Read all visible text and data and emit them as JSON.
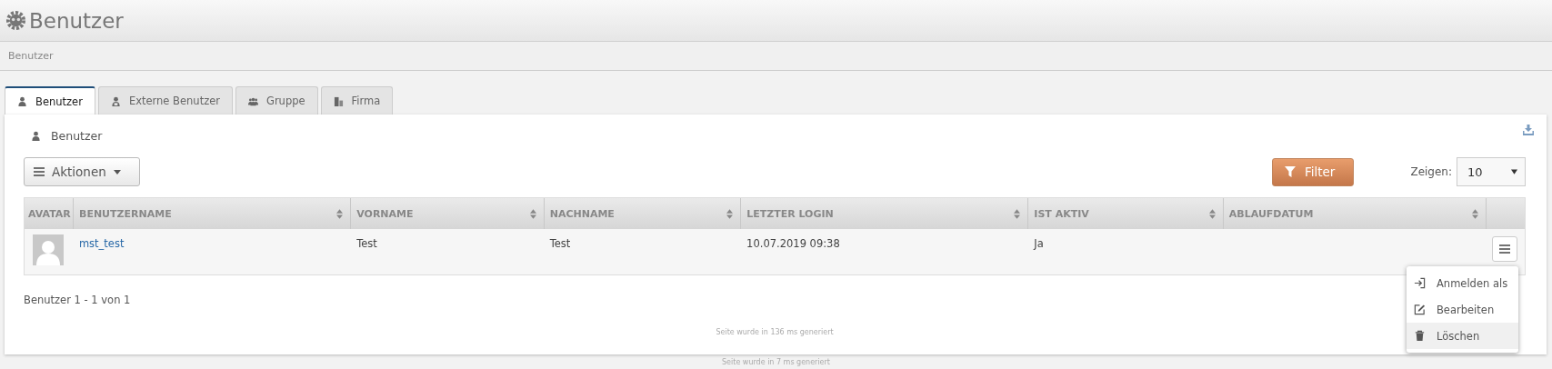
{
  "header": {
    "title": "Benutzer"
  },
  "breadcrumb": "Benutzer",
  "tabs": [
    {
      "label": "Benutzer",
      "selected": true
    },
    {
      "label": "Externe Benutzer",
      "selected": false
    },
    {
      "label": "Gruppe",
      "selected": false
    },
    {
      "label": "Firma",
      "selected": false
    }
  ],
  "panel": {
    "title": "Benutzer",
    "actions_button": "Aktionen",
    "filter_button": "Filter",
    "show_label": "Zeigen:",
    "show_value": "10"
  },
  "table": {
    "columns": [
      {
        "label": "AVATAR",
        "sortable": false
      },
      {
        "label": "BENUTZERNAME",
        "sortable": true
      },
      {
        "label": "VORNAME",
        "sortable": true
      },
      {
        "label": "NACHNAME",
        "sortable": true
      },
      {
        "label": "LETZTER LOGIN",
        "sortable": true
      },
      {
        "label": "IST AKTIV",
        "sortable": true
      },
      {
        "label": "ABLAUFDATUM",
        "sortable": true
      }
    ],
    "rows": [
      {
        "username": "mst_test",
        "first_name": "Test",
        "last_name": "Test",
        "last_login": "10.07.2019 09:38",
        "active": "Ja"
      }
    ]
  },
  "row_menu": [
    {
      "label": "Anmelden als",
      "selected": false
    },
    {
      "label": "Bearbeiten",
      "selected": false
    },
    {
      "label": "Löschen",
      "selected": true
    }
  ],
  "pagination": "Benutzer 1 - 1 von 1",
  "footer_inner": "Seite wurde in 136 ms generiert",
  "footer_outer": "Seite wurde in 7 ms generiert"
}
